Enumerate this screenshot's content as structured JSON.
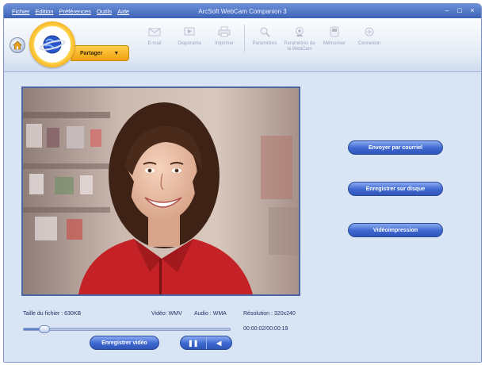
{
  "window": {
    "title": "ArcSoft WebCam Companion 3",
    "menu": [
      "Fichier",
      "Edition",
      "Préférences",
      "Outils",
      "Aide"
    ]
  },
  "mode": {
    "label": "Partager",
    "icon": "globe-icon"
  },
  "toolbar": {
    "tools": [
      {
        "label": "E-mail",
        "icon": "mail-icon"
      },
      {
        "label": "Diaporama",
        "icon": "slideshow-icon"
      },
      {
        "label": "Imprimer",
        "icon": "printer-icon"
      },
      {
        "label": "Paramètres",
        "icon": "magnifier-icon"
      },
      {
        "label": "Paramètres de la WebCam",
        "icon": "webcam-icon"
      },
      {
        "label": "Mémoriser",
        "icon": "save-icon"
      },
      {
        "label": "Connexion",
        "icon": "connect-icon"
      }
    ]
  },
  "actions": {
    "email": "Envoyer par courriel",
    "disk": "Enregistrer sur disque",
    "print": "Vidéoimpression"
  },
  "info": {
    "file_size": "Taille du fichier : 630KB",
    "video": "Vidéo: WMV",
    "audio": "Audio : WMA",
    "resolution": "Résolution : 320x240",
    "time": "00:00:02/00:00:19"
  },
  "playback": {
    "progress": 0.1
  },
  "controls": {
    "record_label": "Enregistrer vidéo",
    "pause_label": "❚❚",
    "stop_label": "◀"
  },
  "colors": {
    "accent": "#3d67d0",
    "mode_orange": "#f2a30f",
    "background": "#d9e5f5"
  }
}
